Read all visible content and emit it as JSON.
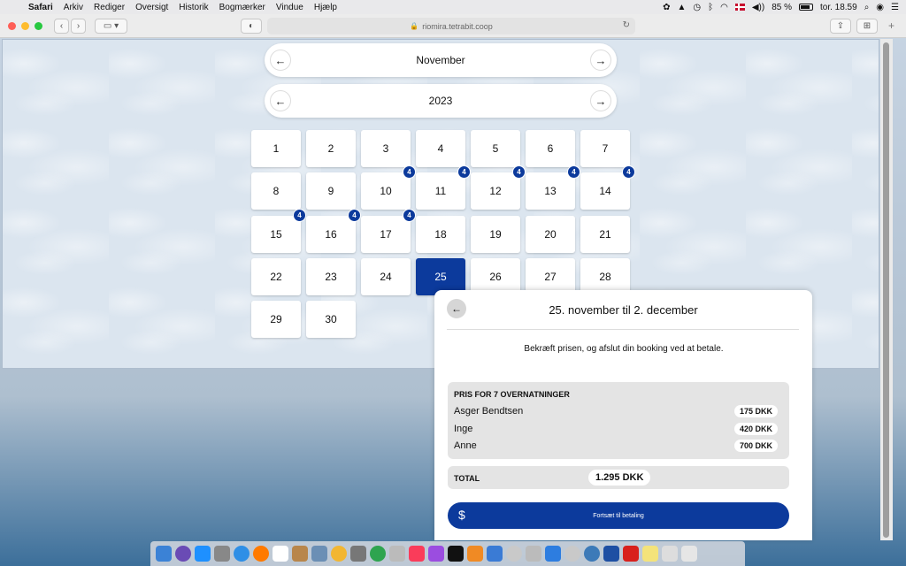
{
  "menubar": {
    "apple": "",
    "items": [
      "Safari",
      "Arkiv",
      "Rediger",
      "Oversigt",
      "Historik",
      "Bogmærker",
      "Vindue",
      "Hjælp"
    ],
    "battery": "85 %",
    "clock": "tor. 18.59"
  },
  "browser": {
    "url": "riomira.tetrabit.coop"
  },
  "calendar": {
    "month": "November",
    "year": "2023",
    "prev_arrow": "←",
    "next_arrow": "→",
    "days": [
      "1",
      "2",
      "3",
      "4",
      "5",
      "6",
      "7",
      "8",
      "9",
      "10",
      "11",
      "12",
      "13",
      "14",
      "15",
      "16",
      "17",
      "18",
      "19",
      "20",
      "21",
      "22",
      "23",
      "24",
      "25",
      "26",
      "27",
      "28",
      "29",
      "30"
    ],
    "selected_day": "25",
    "badge_value": "4"
  },
  "booking": {
    "back_arrow": "←",
    "title": "25. november til 2. december",
    "message": "Bekræft prisen, og afslut din booking ved at betale.",
    "price_header": "PRIS FOR 7 OVERNATNINGER",
    "rows": [
      {
        "name": "Asger Bendtsen",
        "price": "175 DKK"
      },
      {
        "name": "Inge",
        "price": "420 DKK"
      },
      {
        "name": "Anne",
        "price": "700 DKK"
      }
    ],
    "total_label": "TOTAL",
    "total_value": "1.295 DKK",
    "pay_icon": "$",
    "pay_label": "Fortsæt til betaling"
  },
  "colors": {
    "accent": "#0c3a9c",
    "red_light": "#fe5f57",
    "yellow_light": "#febc2e",
    "green_light": "#28c840"
  }
}
